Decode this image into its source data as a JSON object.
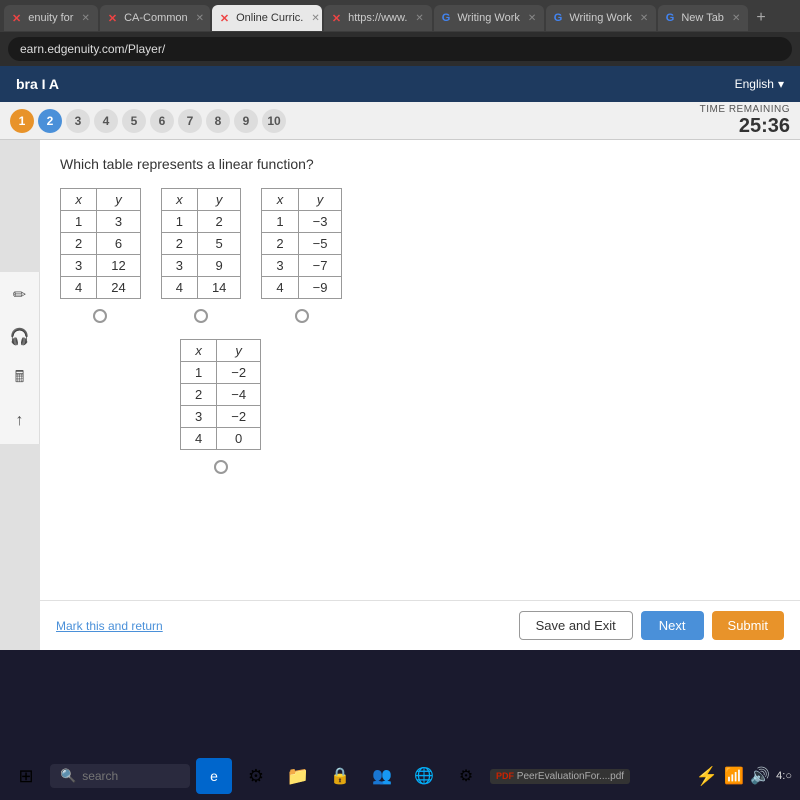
{
  "browser": {
    "tabs": [
      {
        "id": 1,
        "label": "enuity for",
        "icon": "x-red",
        "active": false
      },
      {
        "id": 2,
        "label": "CA-Common",
        "icon": "x-red",
        "active": false
      },
      {
        "id": 3,
        "label": "Online Curric.",
        "icon": "x-red",
        "active": true
      },
      {
        "id": 4,
        "label": "https://www.",
        "icon": "x-red",
        "active": false
      },
      {
        "id": 5,
        "label": "Writing Work",
        "icon": "google",
        "active": false
      },
      {
        "id": 6,
        "label": "Writing Work",
        "icon": "google",
        "active": false
      },
      {
        "id": 7,
        "label": "New Tab",
        "icon": "google",
        "active": false
      }
    ],
    "address": "earn.edgenuity.com/Player/"
  },
  "app": {
    "title": "bra I A",
    "language": "English"
  },
  "quiz": {
    "question_numbers": [
      "1",
      "2",
      "3",
      "4",
      "5",
      "6",
      "7",
      "8",
      "9",
      "10"
    ],
    "active_q": "1",
    "current_q": "2",
    "timer_label": "TIME REMAINING",
    "timer_value": "25:36"
  },
  "question": {
    "text": "Which table represents a linear function?"
  },
  "tables": [
    {
      "id": "A",
      "headers": [
        "x",
        "y"
      ],
      "rows": [
        [
          "1",
          "3"
        ],
        [
          "2",
          "6"
        ],
        [
          "3",
          "12"
        ],
        [
          "4",
          "24"
        ]
      ]
    },
    {
      "id": "B",
      "headers": [
        "x",
        "y"
      ],
      "rows": [
        [
          "1",
          "2"
        ],
        [
          "2",
          "5"
        ],
        [
          "3",
          "9"
        ],
        [
          "4",
          "14"
        ]
      ]
    },
    {
      "id": "C",
      "headers": [
        "x",
        "y"
      ],
      "rows": [
        [
          "1",
          "−3"
        ],
        [
          "2",
          "−5"
        ],
        [
          "3",
          "−7"
        ],
        [
          "4",
          "−9"
        ]
      ]
    },
    {
      "id": "D",
      "headers": [
        "x",
        "y"
      ],
      "rows": [
        [
          "1",
          "−2"
        ],
        [
          "2",
          "−4"
        ],
        [
          "3",
          "−2"
        ],
        [
          "4",
          "0"
        ]
      ]
    }
  ],
  "buttons": {
    "mark_return": "Mark this and return",
    "save_exit": "Save and Exit",
    "next": "Next",
    "submit": "Submit"
  },
  "tools": {
    "pencil": "✏",
    "headphone": "🎧",
    "calculator": "🖩",
    "up_arrow": "↑"
  },
  "taskbar": {
    "search_placeholder": "search",
    "file1": "PeerEvaluationFor....pdf",
    "time": "4:○"
  }
}
